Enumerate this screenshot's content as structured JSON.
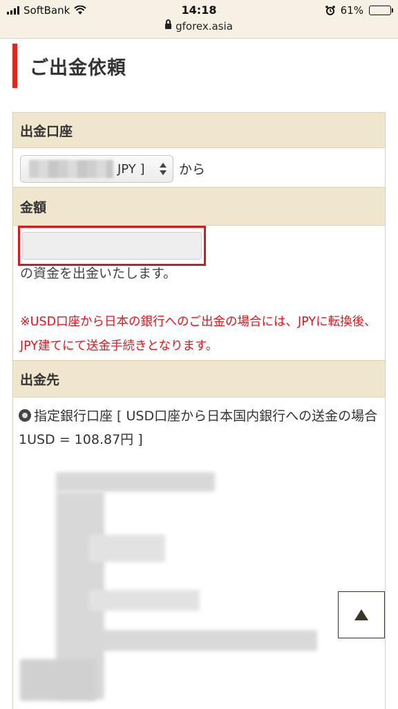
{
  "status_bar": {
    "carrier": "SoftBank",
    "time": "14:18",
    "url": "gforex.asia",
    "battery": "61%",
    "battery_level": 0.61,
    "icons": [
      "signal-icon",
      "wifi-icon",
      "lock-icon",
      "alarm-icon",
      "battery-icon"
    ]
  },
  "page": {
    "title": "ご出金依頼"
  },
  "form": {
    "account": {
      "label": "出金口座",
      "select_value": "JPY ]",
      "suffix": "から"
    },
    "amount": {
      "label": "金額",
      "value": "",
      "suffix": "の資金を出金いたします。",
      "notice": "※USD口座から日本の銀行へのご出金の場合には、JPYに転換後、JPY建てにて送金手続きとなります。"
    },
    "destination": {
      "label": "出金先",
      "option_text": "指定銀行口座 [ USD口座から日本国内銀行への送金の場合 1USD = 108.87円 ]",
      "selected": true
    }
  },
  "colors": {
    "accent_red": "#e0151b",
    "header_bg": "#f0e6cd",
    "border": "#ddd2b6",
    "heading_bar": "#d92a1c"
  }
}
